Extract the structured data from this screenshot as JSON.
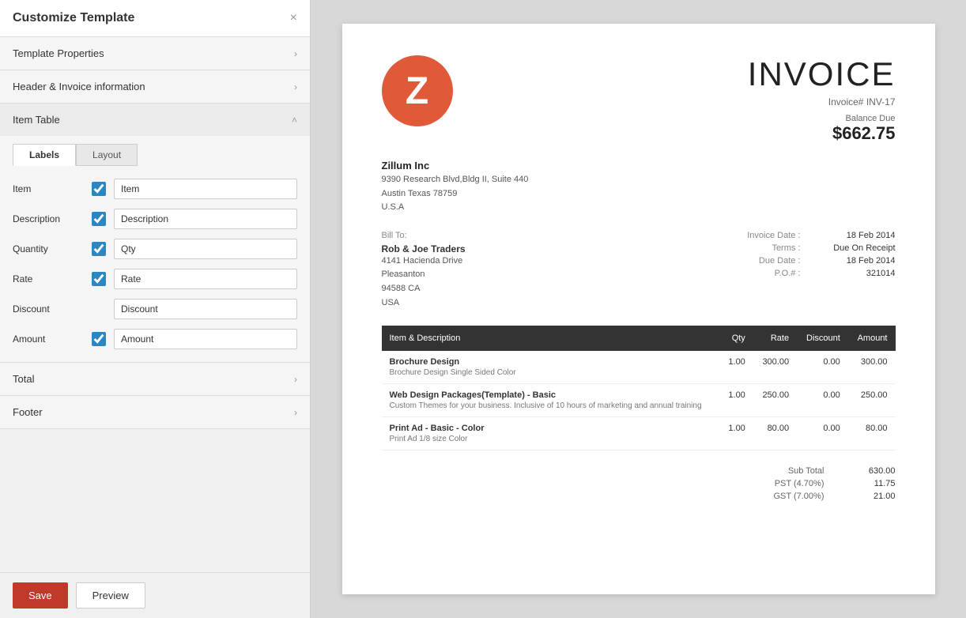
{
  "panel": {
    "title": "Customize Template",
    "close_icon": "×",
    "sections": {
      "template_properties": {
        "label": "Template Properties",
        "chevron": "›"
      },
      "header_invoice": {
        "label": "Header & Invoice information",
        "chevron": "›"
      },
      "item_table": {
        "label": "Item Table",
        "chevron": "˄"
      },
      "total": {
        "label": "Total",
        "chevron": "›"
      },
      "footer": {
        "label": "Footer",
        "chevron": "›"
      }
    },
    "tabs": [
      {
        "id": "labels",
        "label": "Labels",
        "active": true
      },
      {
        "id": "layout",
        "label": "Layout",
        "active": false
      }
    ],
    "fields": [
      {
        "id": "item",
        "label": "Item",
        "checked": true,
        "value": "Item",
        "has_checkbox": true
      },
      {
        "id": "description",
        "label": "Description",
        "checked": true,
        "value": "Description",
        "has_checkbox": true
      },
      {
        "id": "quantity",
        "label": "Quantity",
        "checked": true,
        "value": "Qty",
        "has_checkbox": true
      },
      {
        "id": "rate",
        "label": "Rate",
        "checked": true,
        "value": "Rate",
        "has_checkbox": true
      },
      {
        "id": "discount",
        "label": "Discount",
        "checked": false,
        "value": "Discount",
        "has_checkbox": false
      },
      {
        "id": "amount",
        "label": "Amount",
        "checked": true,
        "value": "Amount",
        "has_checkbox": true
      }
    ],
    "buttons": {
      "save": "Save",
      "preview": "Preview"
    }
  },
  "invoice": {
    "logo_letter": "Z",
    "logo_bg": "#e05a3a",
    "title": "INVOICE",
    "invoice_number_label": "Invoice#",
    "invoice_number": "INV-17",
    "balance_due_label": "Balance Due",
    "balance_due": "$662.75",
    "company": {
      "name": "Zillum Inc",
      "address_line1": "9390 Research Blvd,Bldg II, Suite 440",
      "address_line2": "Austin Texas 78759",
      "address_line3": "U.S.A"
    },
    "bill_to": {
      "label": "Bill To:",
      "name": "Rob & Joe Traders",
      "address_line1": "4141 Hacienda Drive",
      "address_line2": "Pleasanton",
      "address_line3": "94588 CA",
      "address_line4": "USA"
    },
    "details": [
      {
        "key": "Invoice Date :",
        "value": "18 Feb 2014"
      },
      {
        "key": "Terms :",
        "value": "Due On Receipt"
      },
      {
        "key": "Due Date :",
        "value": "18 Feb 2014"
      },
      {
        "key": "P.O.# :",
        "value": "321014"
      }
    ],
    "table": {
      "headers": [
        {
          "label": "Item & Description",
          "align": "left"
        },
        {
          "label": "Qty",
          "align": "right"
        },
        {
          "label": "Rate",
          "align": "right"
        },
        {
          "label": "Discount",
          "align": "right"
        },
        {
          "label": "Amount",
          "align": "right"
        }
      ],
      "rows": [
        {
          "name": "Brochure Design",
          "description": "Brochure Design Single Sided Color",
          "qty": "1.00",
          "rate": "300.00",
          "discount": "0.00",
          "amount": "300.00"
        },
        {
          "name": "Web Design Packages(Template) - Basic",
          "description": "Custom Themes for your business. Inclusive of 10 hours of marketing and annual training",
          "qty": "1.00",
          "rate": "250.00",
          "discount": "0.00",
          "amount": "250.00"
        },
        {
          "name": "Print Ad - Basic - Color",
          "description": "Print Ad 1/8 size Color",
          "qty": "1.00",
          "rate": "80.00",
          "discount": "0.00",
          "amount": "80.00"
        }
      ]
    },
    "totals": [
      {
        "key": "Sub Total",
        "value": "630.00"
      },
      {
        "key": "PST (4.70%)",
        "value": "11.75"
      },
      {
        "key": "GST (7.00%)",
        "value": "21.00"
      }
    ]
  }
}
